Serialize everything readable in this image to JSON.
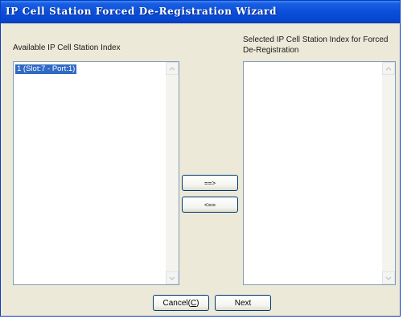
{
  "window": {
    "title": "IP Cell Station Forced De-Registration Wizard"
  },
  "available": {
    "label": "Available IP Cell Station Index",
    "items": [
      "1 (Slot:7 - Port:1)"
    ]
  },
  "selected": {
    "label_line1": "Selected IP Cell Station Index for Forced",
    "label_line2": "De-Registration",
    "items": []
  },
  "buttons": {
    "add": "==>",
    "remove": "<==",
    "cancel_text": "Cancel(",
    "cancel_mnemonic": "C",
    "cancel_close": ")",
    "next": "Next"
  },
  "colors": {
    "titlebar": "#0a4edb",
    "selection": "#316ac5",
    "dialog_bg": "#ece9d8"
  }
}
